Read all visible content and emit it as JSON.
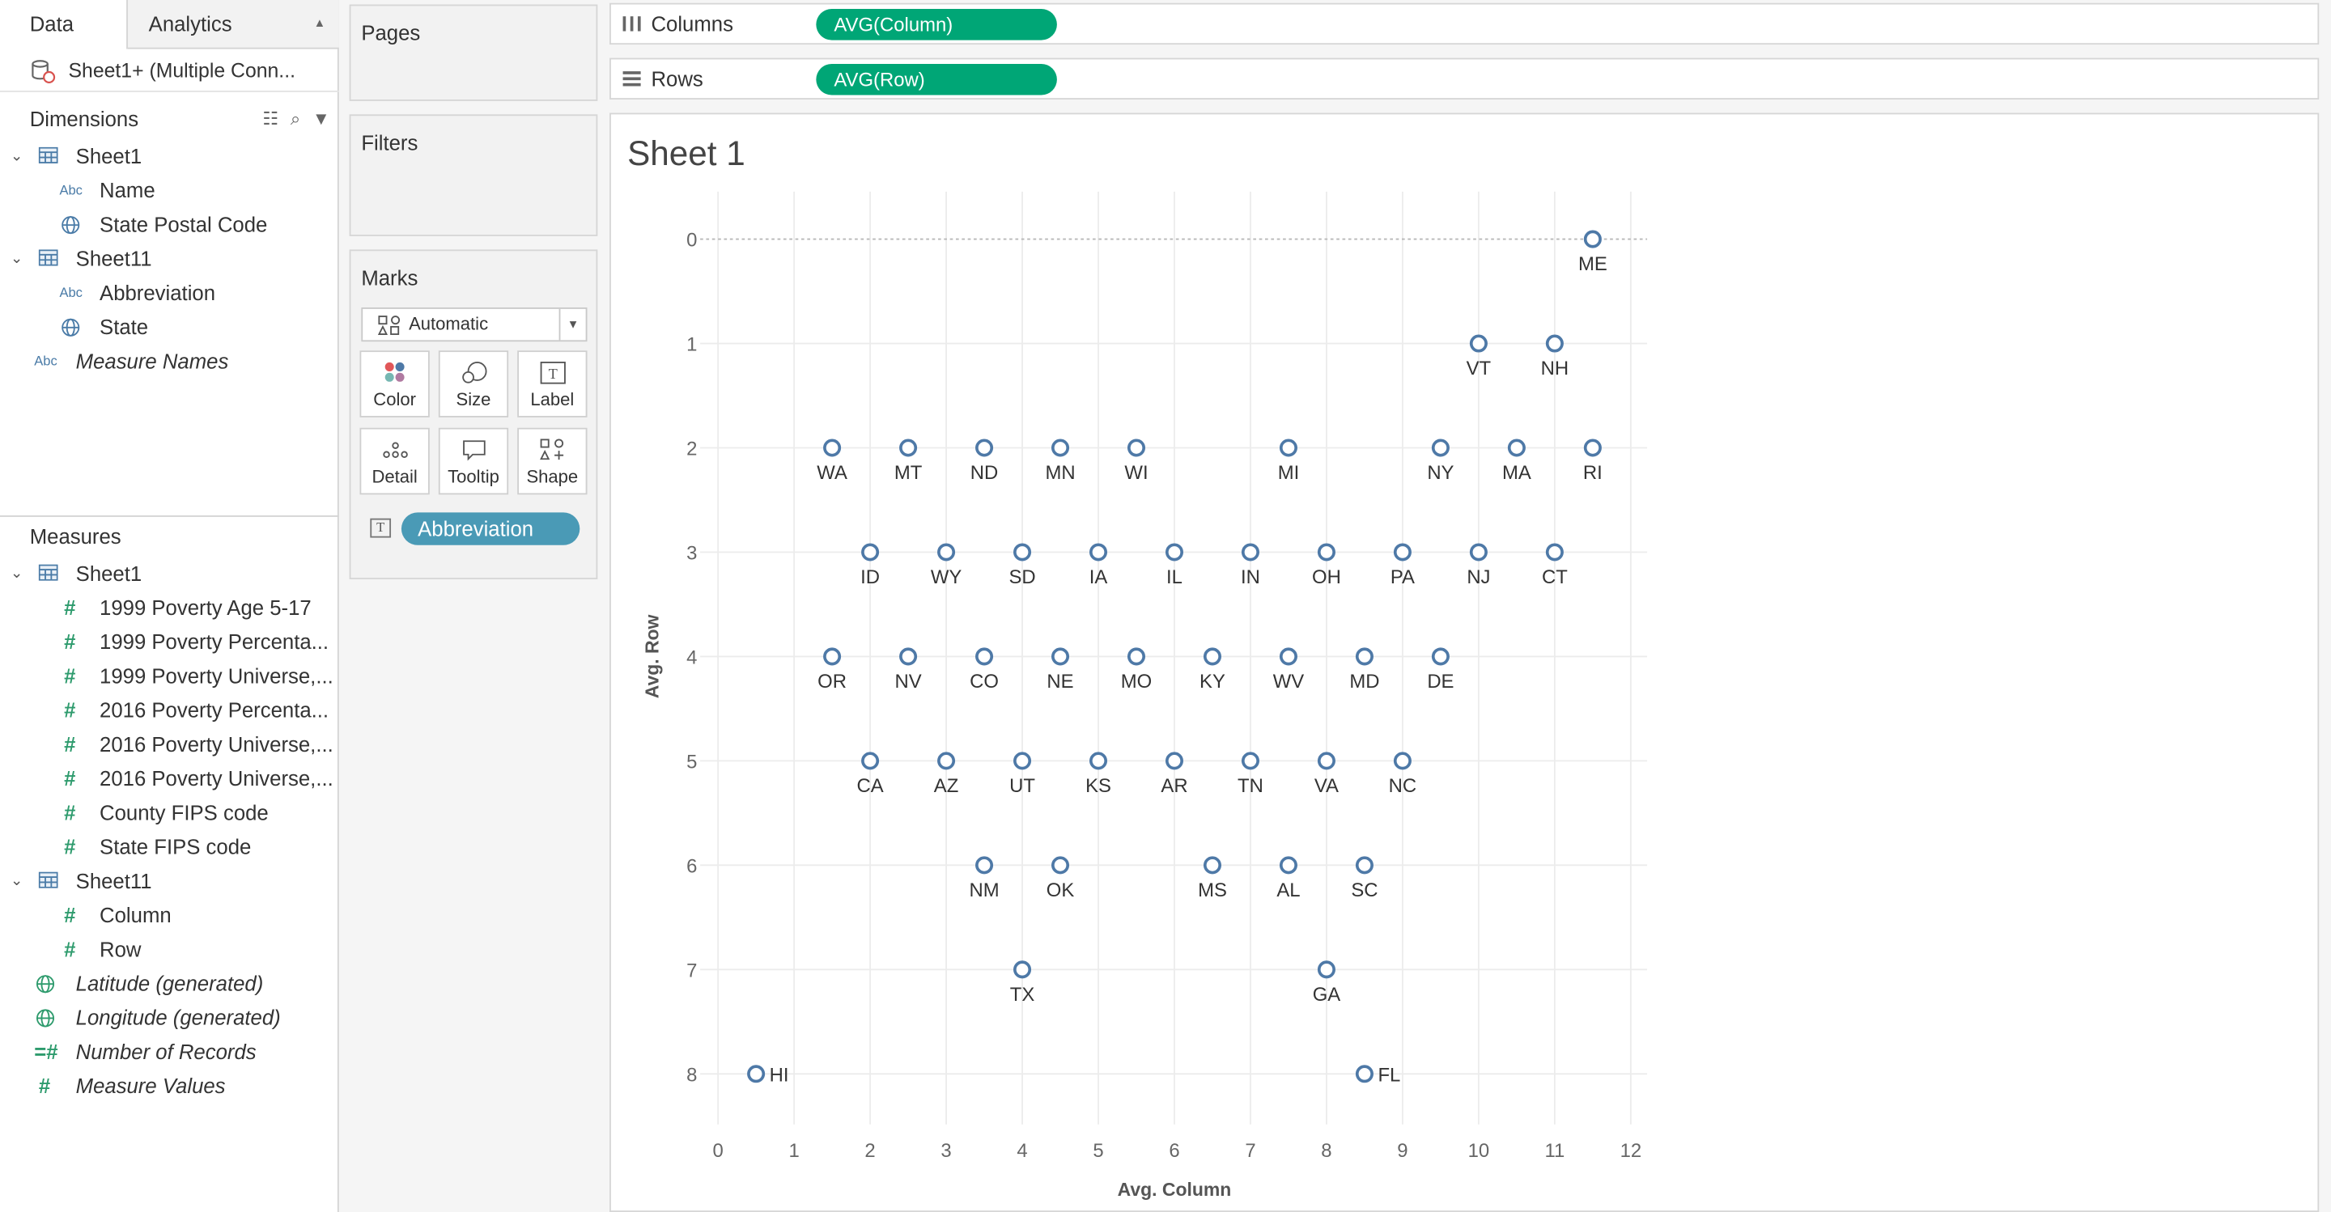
{
  "tabs": {
    "data": "Data",
    "analytics": "Analytics"
  },
  "datasource": "Sheet1+ (Multiple Conn...",
  "dimensions": {
    "title": "Dimensions",
    "items": [
      {
        "label": "Sheet1",
        "kind": "table",
        "level": 0
      },
      {
        "label": "Name",
        "kind": "abc",
        "level": 1
      },
      {
        "label": "State Postal Code",
        "kind": "globe",
        "level": 1
      },
      {
        "label": "Sheet11",
        "kind": "table",
        "level": 0
      },
      {
        "label": "Abbreviation",
        "kind": "abc",
        "level": 1
      },
      {
        "label": "State",
        "kind": "globe",
        "level": 1
      },
      {
        "label": "Measure Names",
        "kind": "abc",
        "level": -1,
        "italic": true
      }
    ]
  },
  "measures": {
    "title": "Measures",
    "items": [
      {
        "label": "Sheet1",
        "kind": "table",
        "level": 0
      },
      {
        "label": "1999 Poverty Age 5-17",
        "kind": "hash",
        "level": 1
      },
      {
        "label": "1999 Poverty Percenta...",
        "kind": "hash",
        "level": 1
      },
      {
        "label": "1999 Poverty Universe,...",
        "kind": "hash",
        "level": 1
      },
      {
        "label": "2016 Poverty Percenta...",
        "kind": "hash",
        "level": 1
      },
      {
        "label": "2016 Poverty Universe,...",
        "kind": "hash",
        "level": 1
      },
      {
        "label": "2016 Poverty Universe,...",
        "kind": "hash",
        "level": 1
      },
      {
        "label": "County FIPS code",
        "kind": "hash",
        "level": 1
      },
      {
        "label": "State FIPS code",
        "kind": "hash",
        "level": 1
      },
      {
        "label": "Sheet11",
        "kind": "table",
        "level": 0
      },
      {
        "label": "Column",
        "kind": "hash",
        "level": 1
      },
      {
        "label": "Row",
        "kind": "hash",
        "level": 1
      },
      {
        "label": "Latitude (generated)",
        "kind": "globe",
        "level": -1,
        "italic": true
      },
      {
        "label": "Longitude (generated)",
        "kind": "globe",
        "level": -1,
        "italic": true
      },
      {
        "label": "Number of Records",
        "kind": "hashdim",
        "level": -1,
        "italic": true
      },
      {
        "label": "Measure Values",
        "kind": "hash",
        "level": -1,
        "italic": true
      }
    ]
  },
  "pages": {
    "title": "Pages"
  },
  "filters": {
    "title": "Filters"
  },
  "marks": {
    "title": "Marks",
    "type": "Automatic",
    "buttons": [
      "Color",
      "Size",
      "Label",
      "Detail",
      "Tooltip",
      "Shape"
    ],
    "label_pill": "Abbreviation"
  },
  "shelves": {
    "columns_label": "Columns",
    "columns_pill": "AVG(Column)",
    "rows_label": "Rows",
    "rows_pill": "AVG(Row)"
  },
  "sheet_title": "Sheet 1",
  "chart_data": {
    "type": "scatter",
    "title": "Sheet 1",
    "xlabel": "Avg. Column",
    "ylabel": "Avg. Row",
    "xlim": [
      0,
      12
    ],
    "ylim": [
      8,
      0
    ],
    "y_reversed": true,
    "x_ticks": [
      0,
      1,
      2,
      3,
      4,
      5,
      6,
      7,
      8,
      9,
      10,
      11,
      12
    ],
    "y_ticks": [
      0,
      1,
      2,
      3,
      4,
      5,
      6,
      7,
      8
    ],
    "grid": true,
    "marker_color": "#4e79a7",
    "points": [
      {
        "label": "ME",
        "x": 11.5,
        "y": 0
      },
      {
        "label": "VT",
        "x": 10,
        "y": 1
      },
      {
        "label": "NH",
        "x": 11,
        "y": 1
      },
      {
        "label": "WA",
        "x": 1.5,
        "y": 2
      },
      {
        "label": "MT",
        "x": 2.5,
        "y": 2
      },
      {
        "label": "ND",
        "x": 3.5,
        "y": 2
      },
      {
        "label": "MN",
        "x": 4.5,
        "y": 2
      },
      {
        "label": "WI",
        "x": 5.5,
        "y": 2
      },
      {
        "label": "MI",
        "x": 7.5,
        "y": 2
      },
      {
        "label": "NY",
        "x": 9.5,
        "y": 2
      },
      {
        "label": "MA",
        "x": 10.5,
        "y": 2
      },
      {
        "label": "RI",
        "x": 11.5,
        "y": 2
      },
      {
        "label": "ID",
        "x": 2,
        "y": 3
      },
      {
        "label": "WY",
        "x": 3,
        "y": 3
      },
      {
        "label": "SD",
        "x": 4,
        "y": 3
      },
      {
        "label": "IA",
        "x": 5,
        "y": 3
      },
      {
        "label": "IL",
        "x": 6,
        "y": 3
      },
      {
        "label": "IN",
        "x": 7,
        "y": 3
      },
      {
        "label": "OH",
        "x": 8,
        "y": 3
      },
      {
        "label": "PA",
        "x": 9,
        "y": 3
      },
      {
        "label": "NJ",
        "x": 10,
        "y": 3
      },
      {
        "label": "CT",
        "x": 11,
        "y": 3
      },
      {
        "label": "OR",
        "x": 1.5,
        "y": 4
      },
      {
        "label": "NV",
        "x": 2.5,
        "y": 4
      },
      {
        "label": "CO",
        "x": 3.5,
        "y": 4
      },
      {
        "label": "NE",
        "x": 4.5,
        "y": 4
      },
      {
        "label": "MO",
        "x": 5.5,
        "y": 4
      },
      {
        "label": "KY",
        "x": 6.5,
        "y": 4
      },
      {
        "label": "WV",
        "x": 7.5,
        "y": 4
      },
      {
        "label": "MD",
        "x": 8.5,
        "y": 4
      },
      {
        "label": "DE",
        "x": 9.5,
        "y": 4
      },
      {
        "label": "CA",
        "x": 2,
        "y": 5
      },
      {
        "label": "AZ",
        "x": 3,
        "y": 5
      },
      {
        "label": "UT",
        "x": 4,
        "y": 5
      },
      {
        "label": "KS",
        "x": 5,
        "y": 5
      },
      {
        "label": "AR",
        "x": 6,
        "y": 5
      },
      {
        "label": "TN",
        "x": 7,
        "y": 5
      },
      {
        "label": "VA",
        "x": 8,
        "y": 5
      },
      {
        "label": "NC",
        "x": 9,
        "y": 5
      },
      {
        "label": "NM",
        "x": 3.5,
        "y": 6
      },
      {
        "label": "OK",
        "x": 4.5,
        "y": 6
      },
      {
        "label": "MS",
        "x": 6.5,
        "y": 6
      },
      {
        "label": "AL",
        "x": 7.5,
        "y": 6
      },
      {
        "label": "SC",
        "x": 8.5,
        "y": 6
      },
      {
        "label": "TX",
        "x": 4,
        "y": 7
      },
      {
        "label": "GA",
        "x": 8,
        "y": 7
      },
      {
        "label": "HI",
        "x": 0.5,
        "y": 8,
        "label_side": "right"
      },
      {
        "label": "FL",
        "x": 8.5,
        "y": 8,
        "label_side": "right"
      }
    ]
  }
}
